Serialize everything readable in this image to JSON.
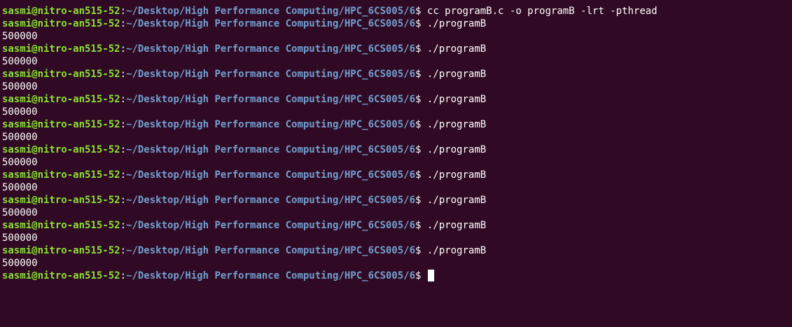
{
  "prompt": {
    "user_host": "sasmi@nitro-an515-52",
    "separator": ":",
    "path": "~/Desktop/High Performance Computing/HPC_6CS005/6",
    "symbol": "$ "
  },
  "lines": [
    {
      "type": "prompt",
      "command": "cc programB.c -o programB -lrt -pthread"
    },
    {
      "type": "prompt",
      "command": "./programB"
    },
    {
      "type": "output",
      "text": "500000"
    },
    {
      "type": "prompt",
      "command": "./programB"
    },
    {
      "type": "output",
      "text": "500000"
    },
    {
      "type": "prompt",
      "command": "./programB"
    },
    {
      "type": "output",
      "text": "500000"
    },
    {
      "type": "prompt",
      "command": "./programB"
    },
    {
      "type": "output",
      "text": "500000"
    },
    {
      "type": "prompt",
      "command": "./programB"
    },
    {
      "type": "output",
      "text": "500000"
    },
    {
      "type": "prompt",
      "command": "./programB"
    },
    {
      "type": "output",
      "text": "500000"
    },
    {
      "type": "prompt",
      "command": "./programB"
    },
    {
      "type": "output",
      "text": "500000"
    },
    {
      "type": "prompt",
      "command": "./programB"
    },
    {
      "type": "output",
      "text": "500000"
    },
    {
      "type": "prompt",
      "command": "./programB"
    },
    {
      "type": "output",
      "text": "500000"
    },
    {
      "type": "prompt",
      "command": "./programB"
    },
    {
      "type": "output",
      "text": "500000"
    },
    {
      "type": "prompt",
      "command": "",
      "cursor": true
    }
  ],
  "colors": {
    "background": "#300a24",
    "user_host": "#8ae234",
    "path": "#729fcf",
    "text": "#ffffff"
  }
}
